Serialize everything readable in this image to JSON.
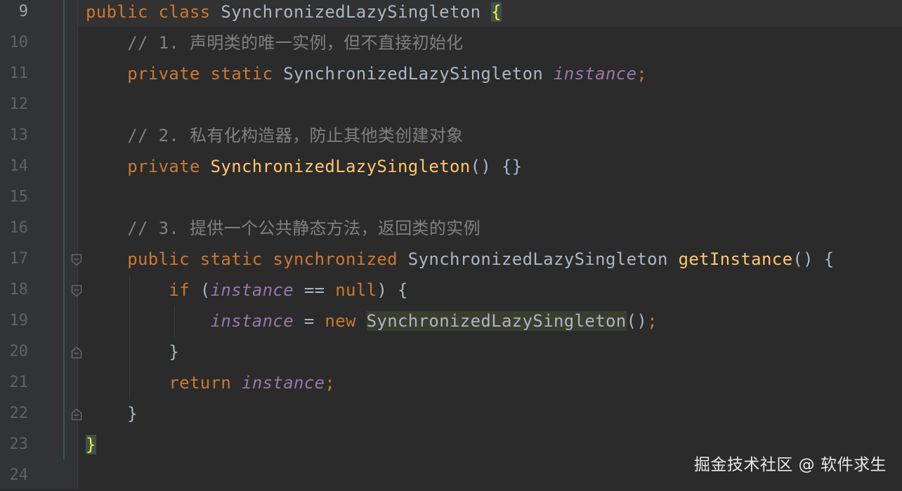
{
  "editor": {
    "line_numbers": [
      "9",
      "10",
      "11",
      "12",
      "13",
      "14",
      "15",
      "16",
      "17",
      "18",
      "19",
      "20",
      "21",
      "22",
      "23",
      "24"
    ],
    "lines": [
      {
        "tokens": [
          {
            "t": "public class ",
            "c": "kw"
          },
          {
            "t": "SynchronizedLazySingleton ",
            "c": "cls"
          },
          {
            "t": "{",
            "c": "brace-hl"
          }
        ]
      },
      {
        "tokens": [
          {
            "t": "    ",
            "c": ""
          },
          {
            "t": "// 1. 声明类的唯一实例，但不直接初始化",
            "c": "cm"
          }
        ]
      },
      {
        "tokens": [
          {
            "t": "    ",
            "c": ""
          },
          {
            "t": "private static ",
            "c": "kw"
          },
          {
            "t": "SynchronizedLazySingleton ",
            "c": "cls"
          },
          {
            "t": "instance",
            "c": "fld"
          },
          {
            "t": ";",
            "c": "kw"
          }
        ]
      },
      {
        "tokens": []
      },
      {
        "tokens": [
          {
            "t": "    ",
            "c": ""
          },
          {
            "t": "// 2. 私有化构造器，防止其他类创建对象",
            "c": "cm"
          }
        ]
      },
      {
        "tokens": [
          {
            "t": "    ",
            "c": ""
          },
          {
            "t": "private ",
            "c": "kw"
          },
          {
            "t": "SynchronizedLazySingleton",
            "c": "fn"
          },
          {
            "t": "() {}",
            "c": "cls"
          }
        ]
      },
      {
        "tokens": []
      },
      {
        "tokens": [
          {
            "t": "    ",
            "c": ""
          },
          {
            "t": "// 3. 提供一个公共静态方法，返回类的实例",
            "c": "cm"
          }
        ]
      },
      {
        "tokens": [
          {
            "t": "    ",
            "c": ""
          },
          {
            "t": "public static synchronized ",
            "c": "kw"
          },
          {
            "t": "SynchronizedLazySingleton ",
            "c": "cls"
          },
          {
            "t": "getInstance",
            "c": "fn"
          },
          {
            "t": "() {",
            "c": "cls"
          }
        ]
      },
      {
        "tokens": [
          {
            "t": "        ",
            "c": ""
          },
          {
            "t": "if ",
            "c": "kw"
          },
          {
            "t": "(",
            "c": "cls"
          },
          {
            "t": "instance",
            "c": "fld"
          },
          {
            "t": " == ",
            "c": "cls"
          },
          {
            "t": "null",
            "c": "kw"
          },
          {
            "t": ") {",
            "c": "cls"
          }
        ]
      },
      {
        "tokens": [
          {
            "t": "            ",
            "c": ""
          },
          {
            "t": "instance",
            "c": "fld"
          },
          {
            "t": " = ",
            "c": "cls"
          },
          {
            "t": "new ",
            "c": "kw"
          },
          {
            "t": "SynchronizedLazySingleton",
            "c": "sel-hl"
          },
          {
            "t": "()",
            "c": "cls"
          },
          {
            "t": ";",
            "c": "kw"
          }
        ]
      },
      {
        "tokens": [
          {
            "t": "        ",
            "c": ""
          },
          {
            "t": "}",
            "c": "cls"
          }
        ]
      },
      {
        "tokens": [
          {
            "t": "        ",
            "c": ""
          },
          {
            "t": "return ",
            "c": "kw"
          },
          {
            "t": "instance",
            "c": "fld"
          },
          {
            "t": ";",
            "c": "kw"
          }
        ]
      },
      {
        "tokens": [
          {
            "t": "    ",
            "c": ""
          },
          {
            "t": "}",
            "c": "cls"
          }
        ]
      },
      {
        "tokens": [
          {
            "t": "}",
            "c": "brace-hl"
          }
        ]
      },
      {
        "tokens": []
      }
    ],
    "fold_markers": [
      {
        "line": 8,
        "kind": "fold-open-icon"
      },
      {
        "line": 9,
        "kind": "fold-open-icon"
      },
      {
        "line": 11,
        "kind": "fold-close-icon"
      },
      {
        "line": 13,
        "kind": "fold-close-icon"
      }
    ]
  },
  "watermark": "掘金技术社区 @ 软件求生",
  "colors": {
    "background": "#2b2b2b",
    "keyword": "#cc7832",
    "function": "#ffc66d",
    "field": "#9876aa",
    "comment": "#808080",
    "plain": "#a9b7c6"
  }
}
